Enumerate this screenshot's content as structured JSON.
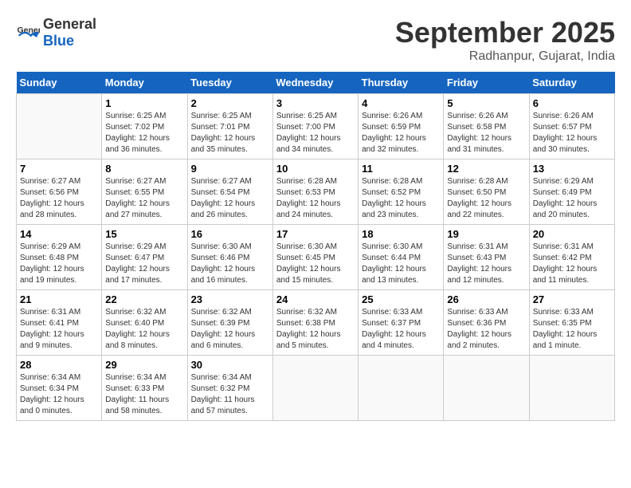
{
  "logo": {
    "general": "General",
    "blue": "Blue"
  },
  "title": "September 2025",
  "subtitle": "Radhanpur, Gujarat, India",
  "days_of_week": [
    "Sunday",
    "Monday",
    "Tuesday",
    "Wednesday",
    "Thursday",
    "Friday",
    "Saturday"
  ],
  "weeks": [
    [
      {
        "day": "",
        "info": ""
      },
      {
        "day": "1",
        "info": "Sunrise: 6:25 AM\nSunset: 7:02 PM\nDaylight: 12 hours\nand 36 minutes."
      },
      {
        "day": "2",
        "info": "Sunrise: 6:25 AM\nSunset: 7:01 PM\nDaylight: 12 hours\nand 35 minutes."
      },
      {
        "day": "3",
        "info": "Sunrise: 6:25 AM\nSunset: 7:00 PM\nDaylight: 12 hours\nand 34 minutes."
      },
      {
        "day": "4",
        "info": "Sunrise: 6:26 AM\nSunset: 6:59 PM\nDaylight: 12 hours\nand 32 minutes."
      },
      {
        "day": "5",
        "info": "Sunrise: 6:26 AM\nSunset: 6:58 PM\nDaylight: 12 hours\nand 31 minutes."
      },
      {
        "day": "6",
        "info": "Sunrise: 6:26 AM\nSunset: 6:57 PM\nDaylight: 12 hours\nand 30 minutes."
      }
    ],
    [
      {
        "day": "7",
        "info": "Sunrise: 6:27 AM\nSunset: 6:56 PM\nDaylight: 12 hours\nand 28 minutes."
      },
      {
        "day": "8",
        "info": "Sunrise: 6:27 AM\nSunset: 6:55 PM\nDaylight: 12 hours\nand 27 minutes."
      },
      {
        "day": "9",
        "info": "Sunrise: 6:27 AM\nSunset: 6:54 PM\nDaylight: 12 hours\nand 26 minutes."
      },
      {
        "day": "10",
        "info": "Sunrise: 6:28 AM\nSunset: 6:53 PM\nDaylight: 12 hours\nand 24 minutes."
      },
      {
        "day": "11",
        "info": "Sunrise: 6:28 AM\nSunset: 6:52 PM\nDaylight: 12 hours\nand 23 minutes."
      },
      {
        "day": "12",
        "info": "Sunrise: 6:28 AM\nSunset: 6:50 PM\nDaylight: 12 hours\nand 22 minutes."
      },
      {
        "day": "13",
        "info": "Sunrise: 6:29 AM\nSunset: 6:49 PM\nDaylight: 12 hours\nand 20 minutes."
      }
    ],
    [
      {
        "day": "14",
        "info": "Sunrise: 6:29 AM\nSunset: 6:48 PM\nDaylight: 12 hours\nand 19 minutes."
      },
      {
        "day": "15",
        "info": "Sunrise: 6:29 AM\nSunset: 6:47 PM\nDaylight: 12 hours\nand 17 minutes."
      },
      {
        "day": "16",
        "info": "Sunrise: 6:30 AM\nSunset: 6:46 PM\nDaylight: 12 hours\nand 16 minutes."
      },
      {
        "day": "17",
        "info": "Sunrise: 6:30 AM\nSunset: 6:45 PM\nDaylight: 12 hours\nand 15 minutes."
      },
      {
        "day": "18",
        "info": "Sunrise: 6:30 AM\nSunset: 6:44 PM\nDaylight: 12 hours\nand 13 minutes."
      },
      {
        "day": "19",
        "info": "Sunrise: 6:31 AM\nSunset: 6:43 PM\nDaylight: 12 hours\nand 12 minutes."
      },
      {
        "day": "20",
        "info": "Sunrise: 6:31 AM\nSunset: 6:42 PM\nDaylight: 12 hours\nand 11 minutes."
      }
    ],
    [
      {
        "day": "21",
        "info": "Sunrise: 6:31 AM\nSunset: 6:41 PM\nDaylight: 12 hours\nand 9 minutes."
      },
      {
        "day": "22",
        "info": "Sunrise: 6:32 AM\nSunset: 6:40 PM\nDaylight: 12 hours\nand 8 minutes."
      },
      {
        "day": "23",
        "info": "Sunrise: 6:32 AM\nSunset: 6:39 PM\nDaylight: 12 hours\nand 6 minutes."
      },
      {
        "day": "24",
        "info": "Sunrise: 6:32 AM\nSunset: 6:38 PM\nDaylight: 12 hours\nand 5 minutes."
      },
      {
        "day": "25",
        "info": "Sunrise: 6:33 AM\nSunset: 6:37 PM\nDaylight: 12 hours\nand 4 minutes."
      },
      {
        "day": "26",
        "info": "Sunrise: 6:33 AM\nSunset: 6:36 PM\nDaylight: 12 hours\nand 2 minutes."
      },
      {
        "day": "27",
        "info": "Sunrise: 6:33 AM\nSunset: 6:35 PM\nDaylight: 12 hours\nand 1 minute."
      }
    ],
    [
      {
        "day": "28",
        "info": "Sunrise: 6:34 AM\nSunset: 6:34 PM\nDaylight: 12 hours\nand 0 minutes."
      },
      {
        "day": "29",
        "info": "Sunrise: 6:34 AM\nSunset: 6:33 PM\nDaylight: 11 hours\nand 58 minutes."
      },
      {
        "day": "30",
        "info": "Sunrise: 6:34 AM\nSunset: 6:32 PM\nDaylight: 11 hours\nand 57 minutes."
      },
      {
        "day": "",
        "info": ""
      },
      {
        "day": "",
        "info": ""
      },
      {
        "day": "",
        "info": ""
      },
      {
        "day": "",
        "info": ""
      }
    ]
  ]
}
